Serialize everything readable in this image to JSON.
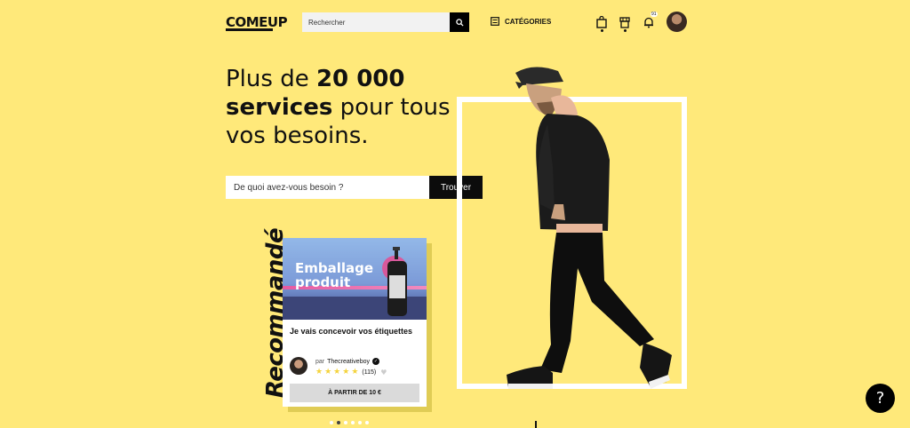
{
  "header": {
    "logo": "COMEUP",
    "search_placeholder": "Rechercher",
    "categories_label": "CATÉGORIES",
    "notification_count": "91"
  },
  "hero": {
    "headline_part1": "Plus de ",
    "headline_bold1": "20 000",
    "headline_bold2": "services",
    "headline_part2": " pour tous vos besoins.",
    "find_placeholder": "De quoi avez-vous besoin ?",
    "find_button": "Trouver"
  },
  "recommended": {
    "label": "Recommandé",
    "card": {
      "image_title_line1": "Emballage",
      "image_title_line2": "produit",
      "description": "Je vais concevoir vos étiquettes",
      "seller_prefix": "par",
      "seller_name": "Thecreativeboy",
      "rating_stars": 5,
      "review_count": "(115)",
      "price_label": "À PARTIR DE 10 €"
    },
    "pager": {
      "total": 6,
      "active": 1
    }
  },
  "help_label": "?",
  "colors": {
    "background": "#FFE97A",
    "accent": "#000000",
    "star": "#F4D33C"
  }
}
